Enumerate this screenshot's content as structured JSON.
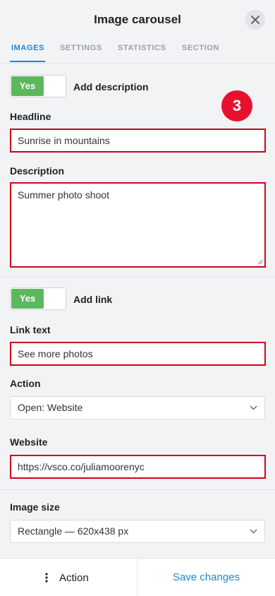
{
  "header": {
    "title": "Image carousel",
    "close_icon": "close-icon"
  },
  "tabs": [
    {
      "label": "IMAGES",
      "active": true
    },
    {
      "label": "SETTINGS",
      "active": false
    },
    {
      "label": "STATISTICS",
      "active": false
    },
    {
      "label": "SECTION",
      "active": false
    }
  ],
  "description_toggle": {
    "state": "Yes",
    "label": "Add description"
  },
  "headline": {
    "label": "Headline",
    "value": "Sunrise in mountains"
  },
  "description": {
    "label": "Description",
    "value": "Summer photo shoot"
  },
  "badge": {
    "value": "3"
  },
  "link_toggle": {
    "state": "Yes",
    "label": "Add link"
  },
  "link_text": {
    "label": "Link text",
    "value": "See more photos"
  },
  "action_select": {
    "label": "Action",
    "value": "Open: Website"
  },
  "website": {
    "label": "Website",
    "value": "https://vsco.co/juliamoorenyc"
  },
  "image_size": {
    "label": "Image size",
    "value": "Rectangle — 620x438 px"
  },
  "footer": {
    "action_label": "Action",
    "save_label": "Save changes"
  },
  "colors": {
    "accent": "#1f86d6",
    "toggle_on": "#5cb85c",
    "error_border": "#d0021b",
    "badge": "#e8112d"
  }
}
